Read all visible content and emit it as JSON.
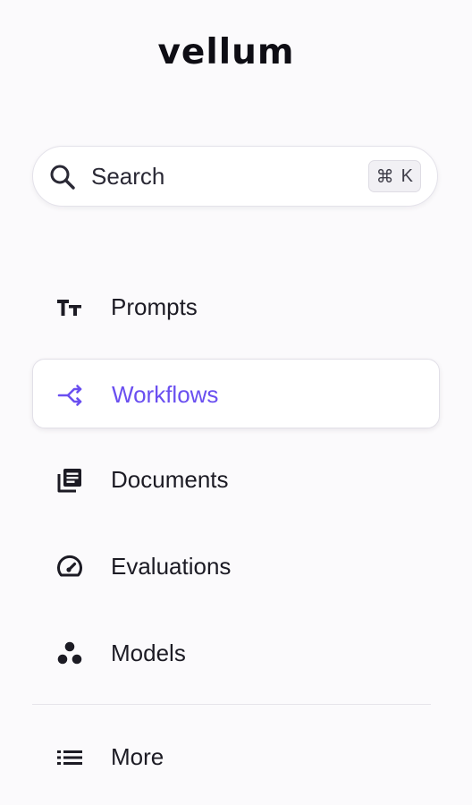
{
  "brand": {
    "logo_text": "vellum"
  },
  "search": {
    "label": "Search",
    "shortcut_symbol": "⌘",
    "shortcut_key": "K"
  },
  "nav": {
    "items": [
      {
        "label": "Prompts",
        "icon": "text-size-icon",
        "active": false
      },
      {
        "label": "Workflows",
        "icon": "workflow-icon",
        "active": true
      },
      {
        "label": "Documents",
        "icon": "documents-icon",
        "active": false
      },
      {
        "label": "Evaluations",
        "icon": "gauge-icon",
        "active": false
      },
      {
        "label": "Models",
        "icon": "models-icon",
        "active": false
      }
    ],
    "more": {
      "label": "More",
      "icon": "list-icon"
    }
  },
  "colors": {
    "accent": "#6a4ff0",
    "text": "#1c1b24",
    "background": "#fbfafc"
  }
}
